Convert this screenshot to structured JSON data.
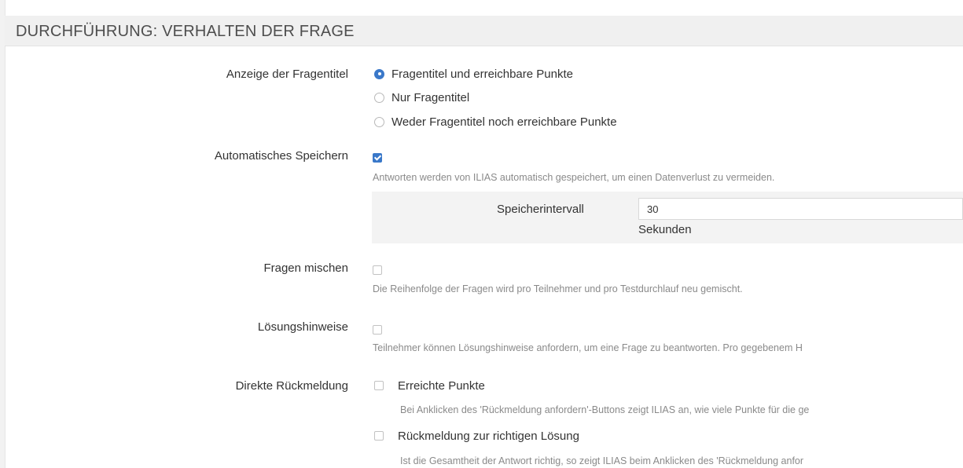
{
  "section": {
    "title": "DURCHFÜHRUNG: VERHALTEN DER FRAGE"
  },
  "question_title_display": {
    "label": "Anzeige der Fragentitel",
    "options": [
      {
        "label": "Fragentitel und erreichbare Punkte",
        "checked": true
      },
      {
        "label": "Nur Fragentitel",
        "checked": false
      },
      {
        "label": "Weder Fragentitel noch erreichbare Punkte",
        "checked": false
      }
    ]
  },
  "autosave": {
    "label": "Automatisches Speichern",
    "checked": true,
    "help": "Antworten werden von ILIAS automatisch gespeichert, um einen Datenverlust zu vermeiden.",
    "interval": {
      "label": "Speicherintervall",
      "value": "30",
      "unit": "Sekunden"
    }
  },
  "shuffle_questions": {
    "label": "Fragen mischen",
    "checked": false,
    "help": "Die Reihenfolge der Fragen wird pro Teilnehmer und pro Testdurchlauf neu gemischt."
  },
  "solution_hints": {
    "label": "Lösungshinweise",
    "checked": false,
    "help": "Teilnehmer können Lösungshinweise anfordern, um eine Frage zu beantworten. Pro gegebenem H"
  },
  "direct_feedback": {
    "label": "Direkte Rückmeldung",
    "options": [
      {
        "label": "Erreichte Punkte",
        "checked": false,
        "help": "Bei Anklicken des 'Rückmeldung anfordern'-Buttons zeigt ILIAS an, wie viele Punkte für die ge"
      },
      {
        "label": "Rückmeldung zur richtigen Lösung",
        "checked": false,
        "help": "Ist die Gesamtheit der Antwort richtig, so zeigt ILIAS beim Anklicken des 'Rückmeldung anfor"
      }
    ]
  },
  "colors": {
    "accent": "#3a78c9",
    "header_bg": "#f0f0f0",
    "help_text": "#8a8a8a"
  }
}
